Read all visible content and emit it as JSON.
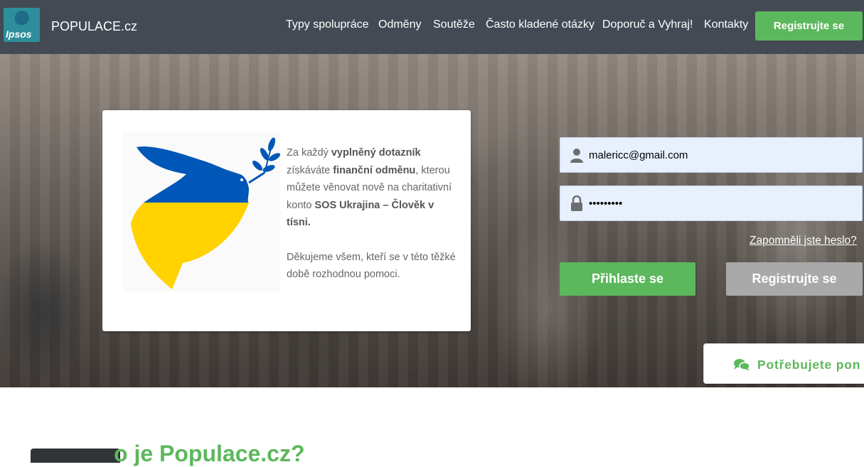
{
  "header": {
    "logo_text": "Ipsos",
    "brand": "POPULACE.cz",
    "nav": [
      {
        "label": "Typy spolupráce",
        "id": "typy-spoluprace"
      },
      {
        "label": "Odměny",
        "id": "odmeny"
      },
      {
        "label": "Soutěže",
        "id": "souteze"
      },
      {
        "label": "Často kladené otázky",
        "id": "faq"
      },
      {
        "label": "Doporuč a Vyhraj!",
        "id": "doporuc"
      },
      {
        "label": "Kontakty",
        "id": "kontakty"
      }
    ],
    "register_label": "Registrujte se"
  },
  "info_card": {
    "line1_pre": "Za každý ",
    "line1_b": "vyplněný dotazník",
    "line1_mid": " získáváte ",
    "line1_b2": "finanční odměnu",
    "line1_post": ", kterou můžete věnovat nově na charitativní konto ",
    "line1_b3": "SOS Ukrajina – Člověk v tísni.",
    "thanks": "Děkujeme všem, kteří se v této těžké době rozhodnou pomoci."
  },
  "login": {
    "email_value": "malericc@gmail.com",
    "password_value": "•••••••••",
    "forgot_label": "Zapomněli jste heslo?",
    "login_label": "Přihlaste se",
    "register_label": "Registrujte se"
  },
  "help": {
    "label": "Potřebujete pon",
    "icon": "chat-icon"
  },
  "section": {
    "title_fragment": "o je Populace.cz?"
  },
  "colors": {
    "header_bg": "#434a54",
    "accent_green": "#5cb85c",
    "register_gray": "#a9a9a9",
    "field_bg": "#e8f0fe"
  }
}
